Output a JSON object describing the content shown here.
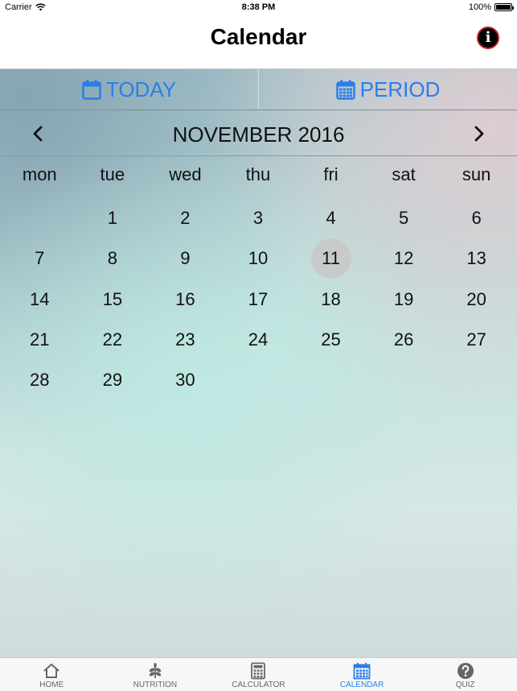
{
  "status_bar": {
    "carrier": "Carrier",
    "time": "8:38 PM",
    "battery": "100%"
  },
  "nav": {
    "title": "Calendar"
  },
  "segments": [
    {
      "label": "TODAY",
      "icon": "calendar-icon"
    },
    {
      "label": "PERIOD",
      "icon": "calendar-grid-icon"
    }
  ],
  "calendar": {
    "month_title": "NOVEMBER 2016",
    "weekdays": [
      "mon",
      "tue",
      "wed",
      "thu",
      "fri",
      "sat",
      "sun"
    ],
    "weeks": [
      [
        "",
        "1",
        "2",
        "3",
        "4",
        "5",
        "6"
      ],
      [
        "7",
        "8",
        "9",
        "10",
        "11",
        "12",
        "13"
      ],
      [
        "14",
        "15",
        "16",
        "17",
        "18",
        "19",
        "20"
      ],
      [
        "21",
        "22",
        "23",
        "24",
        "25",
        "26",
        "27"
      ],
      [
        "28",
        "29",
        "30",
        "",
        "",
        "",
        ""
      ]
    ],
    "selected_day": "11"
  },
  "tabs": [
    {
      "label": "HOME",
      "icon": "home-icon"
    },
    {
      "label": "NUTRITION",
      "icon": "plant-icon"
    },
    {
      "label": "CALCULATOR",
      "icon": "calculator-icon"
    },
    {
      "label": "CALENDAR",
      "icon": "calendar-icon",
      "active": true
    },
    {
      "label": "QUIZ",
      "icon": "question-icon"
    }
  ],
  "colors": {
    "accent": "#2a7fe8",
    "inactive": "#666666",
    "info_border": "#c0202a"
  }
}
